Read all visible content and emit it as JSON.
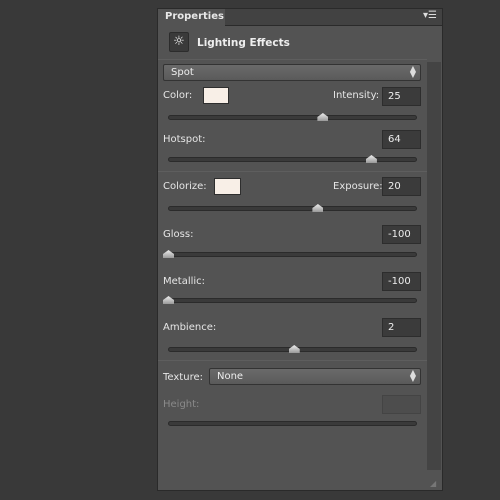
{
  "panel": {
    "tab": "Properties",
    "menu_icon": "panel-menu-icon",
    "title": "Lighting Effects",
    "title_icon": "lighting-effects-icon"
  },
  "light_type": {
    "value": "Spot"
  },
  "color": {
    "label": "Color:",
    "swatch": "#f8efe7"
  },
  "intensity": {
    "label": "Intensity:",
    "value": "25",
    "slider": 0.62
  },
  "hotspot": {
    "label": "Hotspot:",
    "value": "64",
    "slider": 0.815
  },
  "colorize": {
    "label": "Colorize:",
    "swatch": "#f8efe7"
  },
  "exposure": {
    "label": "Exposure:",
    "value": "20",
    "slider": 0.6
  },
  "gloss": {
    "label": "Gloss:",
    "value": "-100",
    "slider": 0
  },
  "metallic": {
    "label": "Metallic:",
    "value": "-100",
    "slider": 0
  },
  "ambience": {
    "label": "Ambience:",
    "value": "2",
    "slider": 0.505
  },
  "texture": {
    "label": "Texture:",
    "value": "None"
  },
  "height": {
    "label": "Height:",
    "value": ""
  }
}
